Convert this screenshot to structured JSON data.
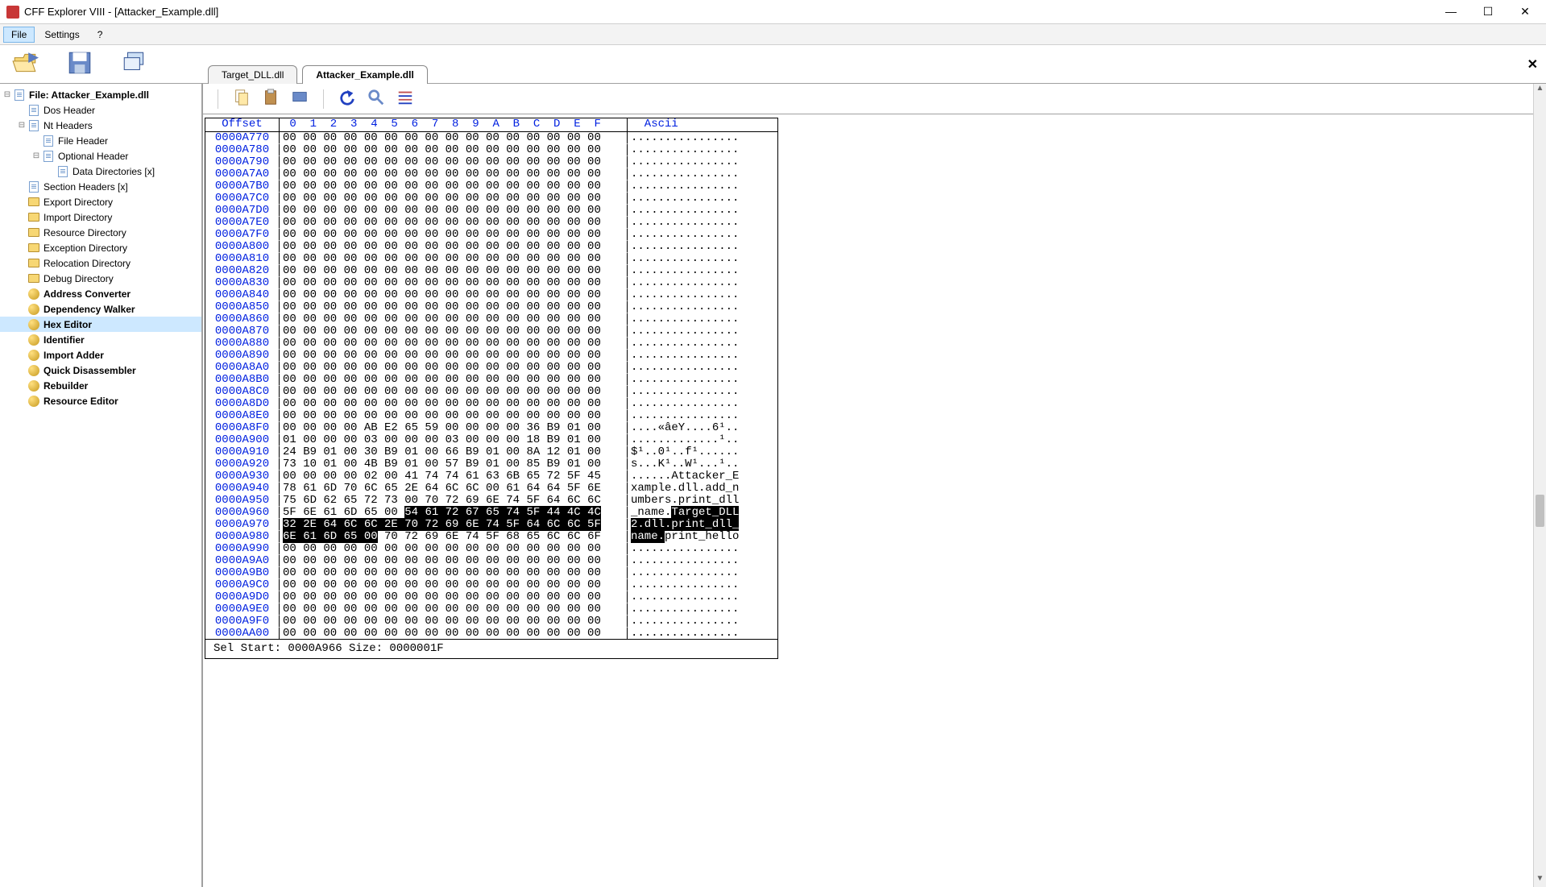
{
  "window": {
    "title": "CFF Explorer VIII - [Attacker_Example.dll]",
    "minimize": "—",
    "maximize": "☐",
    "close": "✕"
  },
  "menubar": {
    "file": "File",
    "settings": "Settings",
    "help": "?"
  },
  "tabs": [
    {
      "label": "Target_DLL.dll",
      "active": false
    },
    {
      "label": "Attacker_Example.dll",
      "active": true
    }
  ],
  "tree": [
    {
      "label": "File: Attacker_Example.dll",
      "depth": 0,
      "iconType": "page",
      "bold": true,
      "box": "minus"
    },
    {
      "label": "Dos Header",
      "depth": 1,
      "iconType": "page"
    },
    {
      "label": "Nt Headers",
      "depth": 1,
      "iconType": "page",
      "box": "minus"
    },
    {
      "label": "File Header",
      "depth": 2,
      "iconType": "page"
    },
    {
      "label": "Optional Header",
      "depth": 2,
      "iconType": "page",
      "box": "minus"
    },
    {
      "label": "Data Directories [x]",
      "depth": 3,
      "iconType": "page"
    },
    {
      "label": "Section Headers [x]",
      "depth": 1,
      "iconType": "page"
    },
    {
      "label": "Export Directory",
      "depth": 1,
      "iconType": "folder"
    },
    {
      "label": "Import Directory",
      "depth": 1,
      "iconType": "folder"
    },
    {
      "label": "Resource Directory",
      "depth": 1,
      "iconType": "folder"
    },
    {
      "label": "Exception Directory",
      "depth": 1,
      "iconType": "folder"
    },
    {
      "label": "Relocation Directory",
      "depth": 1,
      "iconType": "folder"
    },
    {
      "label": "Debug Directory",
      "depth": 1,
      "iconType": "folder"
    },
    {
      "label": "Address Converter",
      "depth": 1,
      "iconType": "tool",
      "bold": true
    },
    {
      "label": "Dependency Walker",
      "depth": 1,
      "iconType": "tool",
      "bold": true
    },
    {
      "label": "Hex Editor",
      "depth": 1,
      "iconType": "tool",
      "bold": true,
      "selected": true
    },
    {
      "label": "Identifier",
      "depth": 1,
      "iconType": "tool",
      "bold": true
    },
    {
      "label": "Import Adder",
      "depth": 1,
      "iconType": "tool",
      "bold": true
    },
    {
      "label": "Quick Disassembler",
      "depth": 1,
      "iconType": "tool",
      "bold": true
    },
    {
      "label": "Rebuilder",
      "depth": 1,
      "iconType": "tool",
      "bold": true
    },
    {
      "label": "Resource Editor",
      "depth": 1,
      "iconType": "tool",
      "bold": true
    }
  ],
  "hex": {
    "header_offset": "Offset",
    "header_hex": " 0  1  2  3  4  5  6  7  8  9  A  B  C  D  E  F ",
    "header_ascii": "  Ascii",
    "status": "Sel Start: 0000A966    Size: 0000001F",
    "rows": [
      {
        "offset": "0000A770",
        "hex": "00 00 00 00 00 00 00 00 00 00 00 00 00 00 00 00",
        "ascii": "................"
      },
      {
        "offset": "0000A780",
        "hex": "00 00 00 00 00 00 00 00 00 00 00 00 00 00 00 00",
        "ascii": "................"
      },
      {
        "offset": "0000A790",
        "hex": "00 00 00 00 00 00 00 00 00 00 00 00 00 00 00 00",
        "ascii": "................"
      },
      {
        "offset": "0000A7A0",
        "hex": "00 00 00 00 00 00 00 00 00 00 00 00 00 00 00 00",
        "ascii": "................"
      },
      {
        "offset": "0000A7B0",
        "hex": "00 00 00 00 00 00 00 00 00 00 00 00 00 00 00 00",
        "ascii": "................"
      },
      {
        "offset": "0000A7C0",
        "hex": "00 00 00 00 00 00 00 00 00 00 00 00 00 00 00 00",
        "ascii": "................"
      },
      {
        "offset": "0000A7D0",
        "hex": "00 00 00 00 00 00 00 00 00 00 00 00 00 00 00 00",
        "ascii": "................"
      },
      {
        "offset": "0000A7E0",
        "hex": "00 00 00 00 00 00 00 00 00 00 00 00 00 00 00 00",
        "ascii": "................"
      },
      {
        "offset": "0000A7F0",
        "hex": "00 00 00 00 00 00 00 00 00 00 00 00 00 00 00 00",
        "ascii": "................"
      },
      {
        "offset": "0000A800",
        "hex": "00 00 00 00 00 00 00 00 00 00 00 00 00 00 00 00",
        "ascii": "................"
      },
      {
        "offset": "0000A810",
        "hex": "00 00 00 00 00 00 00 00 00 00 00 00 00 00 00 00",
        "ascii": "................"
      },
      {
        "offset": "0000A820",
        "hex": "00 00 00 00 00 00 00 00 00 00 00 00 00 00 00 00",
        "ascii": "................"
      },
      {
        "offset": "0000A830",
        "hex": "00 00 00 00 00 00 00 00 00 00 00 00 00 00 00 00",
        "ascii": "................"
      },
      {
        "offset": "0000A840",
        "hex": "00 00 00 00 00 00 00 00 00 00 00 00 00 00 00 00",
        "ascii": "................"
      },
      {
        "offset": "0000A850",
        "hex": "00 00 00 00 00 00 00 00 00 00 00 00 00 00 00 00",
        "ascii": "................"
      },
      {
        "offset": "0000A860",
        "hex": "00 00 00 00 00 00 00 00 00 00 00 00 00 00 00 00",
        "ascii": "................"
      },
      {
        "offset": "0000A870",
        "hex": "00 00 00 00 00 00 00 00 00 00 00 00 00 00 00 00",
        "ascii": "................"
      },
      {
        "offset": "0000A880",
        "hex": "00 00 00 00 00 00 00 00 00 00 00 00 00 00 00 00",
        "ascii": "................"
      },
      {
        "offset": "0000A890",
        "hex": "00 00 00 00 00 00 00 00 00 00 00 00 00 00 00 00",
        "ascii": "................"
      },
      {
        "offset": "0000A8A0",
        "hex": "00 00 00 00 00 00 00 00 00 00 00 00 00 00 00 00",
        "ascii": "................"
      },
      {
        "offset": "0000A8B0",
        "hex": "00 00 00 00 00 00 00 00 00 00 00 00 00 00 00 00",
        "ascii": "................"
      },
      {
        "offset": "0000A8C0",
        "hex": "00 00 00 00 00 00 00 00 00 00 00 00 00 00 00 00",
        "ascii": "................"
      },
      {
        "offset": "0000A8D0",
        "hex": "00 00 00 00 00 00 00 00 00 00 00 00 00 00 00 00",
        "ascii": "................"
      },
      {
        "offset": "0000A8E0",
        "hex": "00 00 00 00 00 00 00 00 00 00 00 00 00 00 00 00",
        "ascii": "................"
      },
      {
        "offset": "0000A8F0",
        "hex": "00 00 00 00 AB E2 65 59 00 00 00 00 36 B9 01 00",
        "ascii": "....«âeY....6¹.."
      },
      {
        "offset": "0000A900",
        "hex": "01 00 00 00 03 00 00 00 03 00 00 00 18 B9 01 00",
        "ascii": ".............¹.."
      },
      {
        "offset": "0000A910",
        "hex": "24 B9 01 00 30 B9 01 00 66 B9 01 00 8A 12 01 00",
        "ascii": "$¹..0¹..f¹......"
      },
      {
        "offset": "0000A920",
        "hex": "73 10 01 00 4B B9 01 00 57 B9 01 00 85 B9 01 00",
        "ascii": "s...K¹..W¹...¹.."
      },
      {
        "offset": "0000A930",
        "hex": "00 00 00 00 02 00 41 74 74 61 63 6B 65 72 5F 45",
        "ascii": "......Attacker_E"
      },
      {
        "offset": "0000A940",
        "hex": "78 61 6D 70 6C 65 2E 64 6C 6C 00 61 64 64 5F 6E",
        "ascii": "xample.dll.add_n"
      },
      {
        "offset": "0000A950",
        "hex": "75 6D 62 65 72 73 00 70 72 69 6E 74 5F 64 6C 6C",
        "ascii": "umbers.print_dll"
      },
      {
        "offset": "0000A960",
        "hex_pre": "5F 6E 61 6D 65 00 ",
        "hex_sel": "54 61 72 67 65 74 5F 44 4C 4C",
        "ascii_pre": "_name.",
        "ascii_sel": "Target_DLL"
      },
      {
        "offset": "0000A970",
        "hex_sel": "32 2E 64 6C 6C 2E 70 72 69 6E 74 5F 64 6C 6C 5F",
        "ascii_sel": "2.dll.print_dll_"
      },
      {
        "offset": "0000A980",
        "hex_sel": "6E 61 6D 65 00",
        "hex_post": " 70 72 69 6E 74 5F 68 65 6C 6C 6F",
        "ascii_sel": "name.",
        "ascii_post": "print_hello"
      },
      {
        "offset": "0000A990",
        "hex": "00 00 00 00 00 00 00 00 00 00 00 00 00 00 00 00",
        "ascii": "................"
      },
      {
        "offset": "0000A9A0",
        "hex": "00 00 00 00 00 00 00 00 00 00 00 00 00 00 00 00",
        "ascii": "................"
      },
      {
        "offset": "0000A9B0",
        "hex": "00 00 00 00 00 00 00 00 00 00 00 00 00 00 00 00",
        "ascii": "................"
      },
      {
        "offset": "0000A9C0",
        "hex": "00 00 00 00 00 00 00 00 00 00 00 00 00 00 00 00",
        "ascii": "................"
      },
      {
        "offset": "0000A9D0",
        "hex": "00 00 00 00 00 00 00 00 00 00 00 00 00 00 00 00",
        "ascii": "................"
      },
      {
        "offset": "0000A9E0",
        "hex": "00 00 00 00 00 00 00 00 00 00 00 00 00 00 00 00",
        "ascii": "................"
      },
      {
        "offset": "0000A9F0",
        "hex": "00 00 00 00 00 00 00 00 00 00 00 00 00 00 00 00",
        "ascii": "................"
      },
      {
        "offset": "0000AA00",
        "hex": "00 00 00 00 00 00 00 00 00 00 00 00 00 00 00 00",
        "ascii": "................"
      }
    ]
  }
}
